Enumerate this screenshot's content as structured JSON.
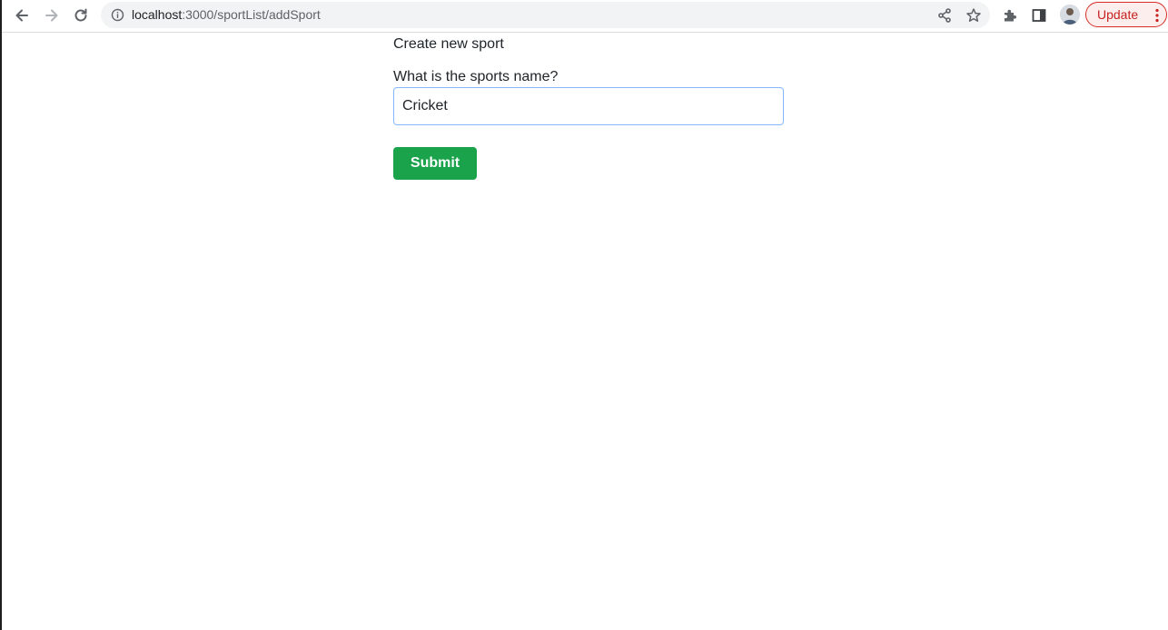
{
  "browser": {
    "url_host": "localhost",
    "url_path": ":3000/sportList/addSport",
    "update_label": "Update",
    "icons": [
      "back-icon",
      "forward-icon",
      "reload-icon",
      "info-icon",
      "share-icon",
      "star-icon",
      "extensions-icon",
      "side-panel-icon",
      "avatar",
      "more-icon"
    ],
    "colors": {
      "update_accent": "#d93025",
      "omnibox_bg": "#f1f3f4"
    }
  },
  "page": {
    "title": "Create new sport",
    "field_label": "What is the sports name?",
    "input_value": "Cricket",
    "submit_label": "Submit",
    "colors": {
      "submit_bg": "#1aa34a",
      "input_focus_border": "#86b7fe"
    }
  }
}
